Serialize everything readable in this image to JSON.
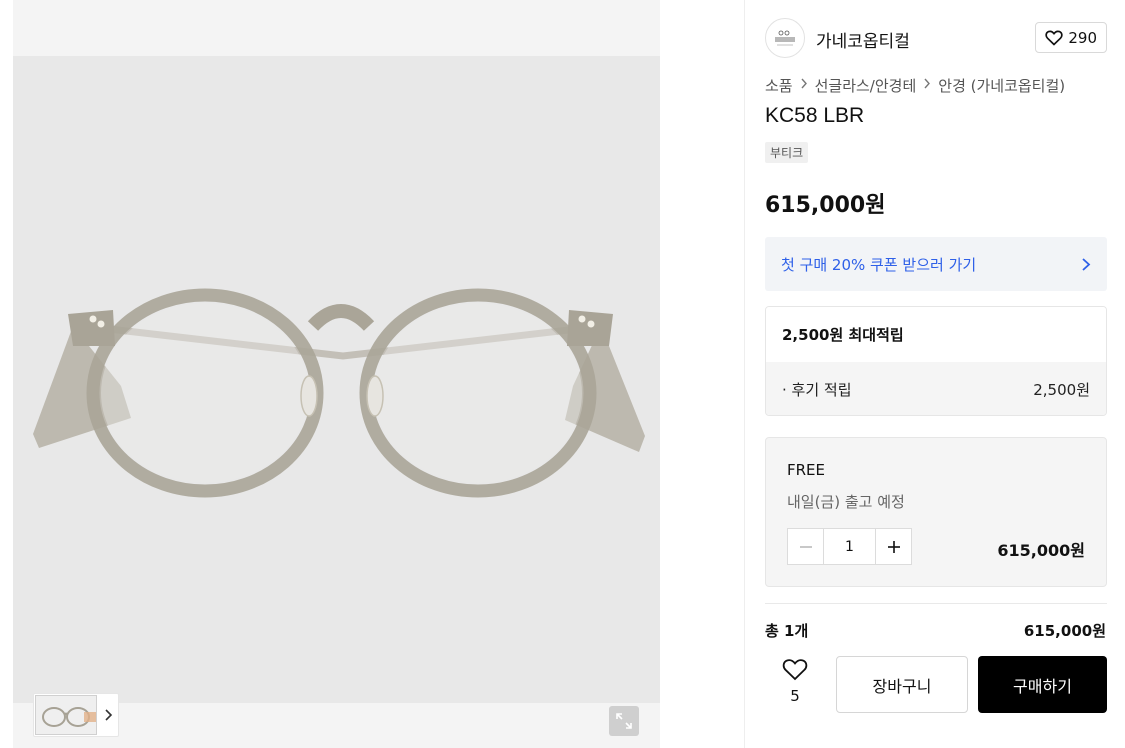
{
  "gallery": {
    "image_alt_icon": "eyeglasses-image",
    "thumb_arrow_icon": "chevron-right-icon",
    "expand_icon": "expand-icon"
  },
  "brand": {
    "name": "가네코옵티컬",
    "logo_icon": "brand-logo",
    "like_count": "290",
    "like_icon": "heart-outline-icon"
  },
  "breadcrumb": [
    "소품",
    "선글라스/안경테",
    "안경 (가네코옵티컬)"
  ],
  "product": {
    "title": "KC58 LBR",
    "tag": "부티크",
    "price": "615,000원"
  },
  "coupon": {
    "text": "첫 구매 20% 쿠폰 받으러 가기",
    "color": "#2e60e8"
  },
  "points": {
    "headline": "2,500원 최대적립",
    "row_label": "· 후기 적립",
    "row_value": "2,500원"
  },
  "option": {
    "name": "FREE",
    "shipping": "내일(금) 출고 예정",
    "quantity": "1",
    "price": "615,000원"
  },
  "total": {
    "label": "총 1개",
    "price": "615,000원"
  },
  "actions": {
    "wish_count": "5",
    "cart_label": "장바구니",
    "buy_label": "구매하기"
  }
}
